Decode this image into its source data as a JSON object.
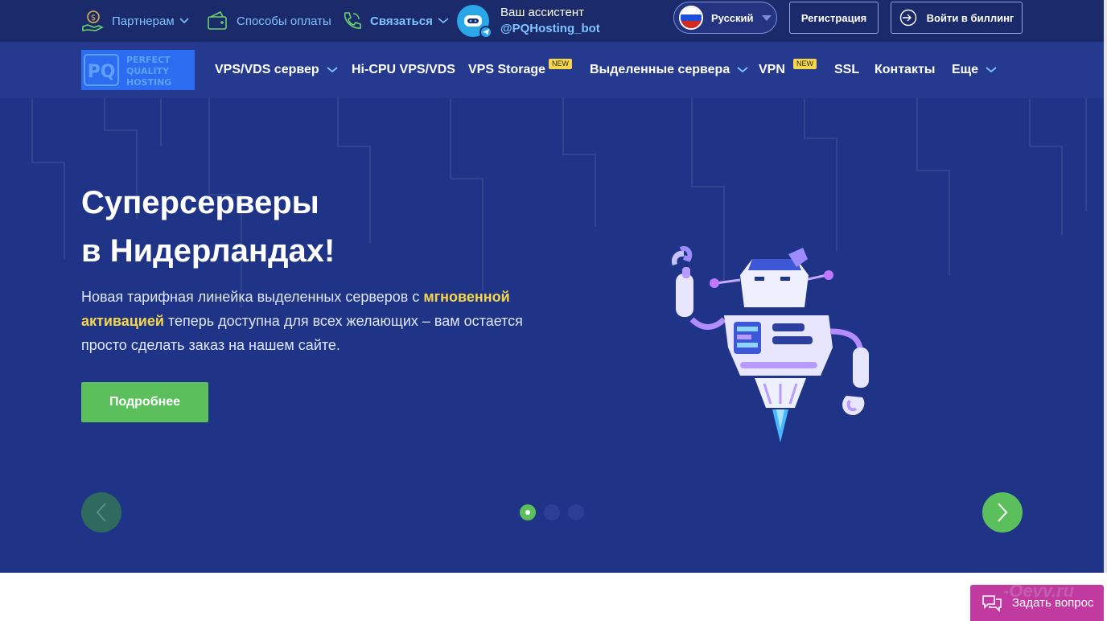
{
  "topbar": {
    "partners_label": "Партнерам",
    "payment_label": "Способы оплаты",
    "contact_label": "Связаться",
    "assistant_label": "Ваш ассистент",
    "assistant_bot": "@PQHosting_bot",
    "language_label": "Русский",
    "register_label": "Регистрация",
    "billing_label": "Войти в биллинг"
  },
  "logo": {
    "line1": "PERFECT",
    "line2": "QUALITY",
    "line3": "HOSTING",
    "mark": "PQ"
  },
  "nav": {
    "items": [
      {
        "label": "VPS/VDS сервер"
      },
      {
        "label": "Hi-CPU VPS/VDS"
      },
      {
        "label": "VPS Storage",
        "badge": "NEW"
      },
      {
        "label": "Выделенные сервера"
      },
      {
        "label": "VPN",
        "badge": "NEW"
      },
      {
        "label": "SSL"
      },
      {
        "label": "Контакты"
      },
      {
        "label": "Еще"
      }
    ]
  },
  "hero": {
    "title_line1": "Суперсерверы",
    "title_line2": "в Нидерландах!",
    "text_part1": "Новая тарифная линейка выделенных серверов с ",
    "text_highlight1": "мгновенной",
    "text_highlight2": "активацией",
    "text_part2": " теперь доступна для всех желающих – вам остается просто сделать заказ на нашем сайте.",
    "button_label": "Подробнее",
    "slides_count": 3,
    "active_slide": 1
  },
  "chat": {
    "label": "Задать вопрос",
    "watermark": "-Oevv.ru"
  },
  "colors": {
    "topbar_bg": "#1b2a6b",
    "navbar_bg": "#253a8f",
    "hero_bg": "#1f3486",
    "accent_green": "#5bbf5b",
    "highlight_yellow": "#f6d64a",
    "link_blue": "#7fc3ff",
    "chat_magenta": "#c03aa0"
  },
  "icons": {
    "partners": "money-hand-icon",
    "payment": "wallet-icon",
    "contact": "phone-icon",
    "assistant": "robot-avatar-icon",
    "telegram": "telegram-icon",
    "chat": "chat-bubbles-icon"
  }
}
